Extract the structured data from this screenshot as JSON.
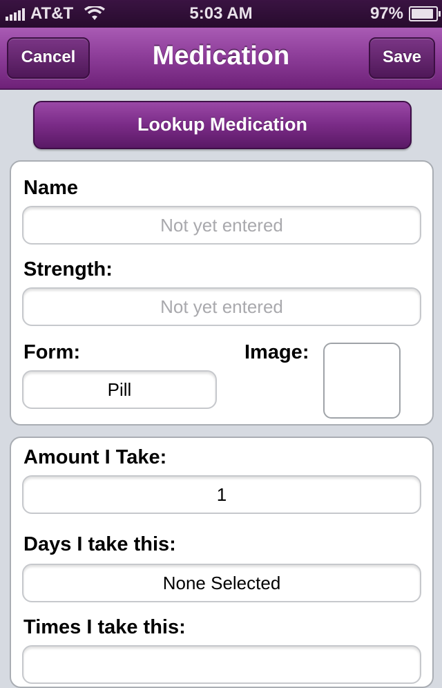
{
  "status_bar": {
    "carrier": "AT&T",
    "time": "5:03 AM",
    "battery": "97%",
    "icons": [
      "signal-icon",
      "wifi-icon",
      "battery-icon"
    ]
  },
  "nav": {
    "title": "Medication",
    "cancel_label": "Cancel",
    "save_label": "Save"
  },
  "lookup_label": "Lookup Medication",
  "form": {
    "name_label": "Name",
    "name_placeholder": "Not yet entered",
    "strength_label": "Strength:",
    "strength_placeholder": "Not yet entered",
    "form_label": "Form:",
    "form_value": "Pill",
    "image_label": "Image:"
  },
  "schedule": {
    "amount_label": "Amount I Take:",
    "amount_value": "1",
    "days_label": "Days I take this:",
    "days_value": "None Selected",
    "times_label": "Times I take this:",
    "times_value": ""
  },
  "colors": {
    "accent": "#8e3e9a",
    "status_bar": "#2f0f36",
    "background": "#d6dae1"
  }
}
